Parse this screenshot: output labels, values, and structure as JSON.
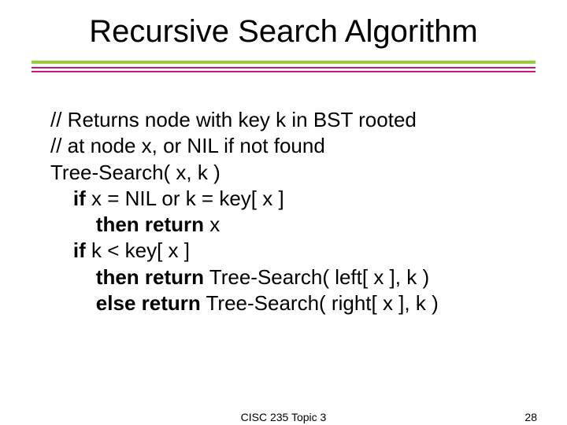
{
  "title": "Recursive Search Algorithm",
  "lines": {
    "l0": "// Returns node with key k in BST rooted",
    "l1": "// at node x, or NIL if not found",
    "l2": "Tree-Search( x, k )",
    "l3a": "    ",
    "l3b": "if",
    "l3c": " x = NIL or k = key[ x ]",
    "l4a": "        ",
    "l4b": "then return",
    "l4c": " x",
    "l5a": "    ",
    "l5b": "if",
    "l5c": " k < key[ x ]",
    "l6a": "        ",
    "l6b": "then return",
    "l6c": " Tree-Search( left[ x ], k )",
    "l7a": "        ",
    "l7b": "else return",
    "l7c": " Tree-Search( right[ x ], k )"
  },
  "footer": {
    "center": "CISC 235 Topic 3",
    "page": "28"
  },
  "colors": {
    "rule_green": "#9acd32",
    "rule_magenta": "#c71585"
  }
}
